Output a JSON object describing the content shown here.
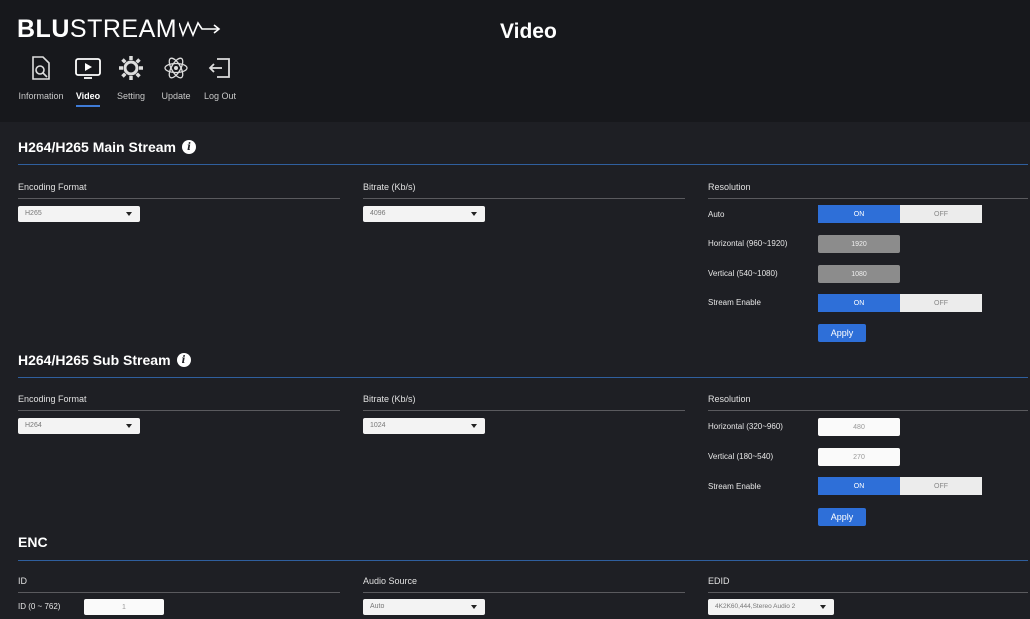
{
  "header": {
    "logo_bold": "BLU",
    "logo_light": "STREAM",
    "title": "Video"
  },
  "nav": [
    {
      "label": "Information",
      "icon": "search-document-icon"
    },
    {
      "label": "Video",
      "icon": "play-screen-icon",
      "active": true
    },
    {
      "label": "Setting",
      "icon": "gear-icon"
    },
    {
      "label": "Update",
      "icon": "atom-icon"
    },
    {
      "label": "Log Out",
      "icon": "logout-icon"
    }
  ],
  "main_stream": {
    "title": "H264/H265 Main Stream",
    "encoding_format_label": "Encoding Format",
    "encoding_format_value": "H265",
    "bitrate_label": "Bitrate  (Kb/s)",
    "bitrate_value": "4096",
    "resolution_label": "Resolution",
    "auto_label": "Auto",
    "auto_on": "ON",
    "auto_off": "OFF",
    "horizontal_label": "Horizontal  (960~1920)",
    "horizontal_value": "1920",
    "vertical_label": "Vertical  (540~1080)",
    "vertical_value": "1080",
    "stream_enable_label": "Stream Enable",
    "stream_on": "ON",
    "stream_off": "OFF",
    "apply": "Apply"
  },
  "sub_stream": {
    "title": "H264/H265 Sub Stream",
    "encoding_format_label": "Encoding Format",
    "encoding_format_value": "H264",
    "bitrate_label": "Bitrate  (Kb/s)",
    "bitrate_value": "1024",
    "resolution_label": "Resolution",
    "horizontal_label": "Horizontal  (320~960)",
    "horizontal_value": "480",
    "vertical_label": "Vertical  (180~540)",
    "vertical_value": "270",
    "stream_enable_label": "Stream Enable",
    "stream_on": "ON",
    "stream_off": "OFF",
    "apply": "Apply"
  },
  "enc": {
    "title": "ENC",
    "id_label": "ID",
    "id_range_label": "ID  (0 ~ 762)",
    "id_value": "1",
    "audio_source_label": "Audio Source",
    "audio_source_value": "Auto",
    "edid_label": "EDID",
    "edid_value": "4K2K60,444,Stereo Audio 2"
  },
  "colors": {
    "accent": "#2e6fd8",
    "background": "#1e1f24",
    "header": "#17181c"
  }
}
